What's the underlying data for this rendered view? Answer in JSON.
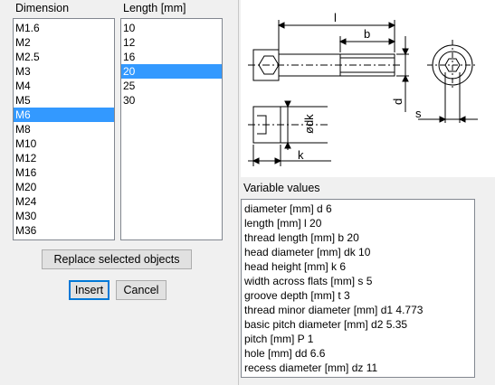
{
  "dimension": {
    "header": "Dimension",
    "items": [
      "M1.6",
      "M2",
      "M2.5",
      "M3",
      "M4",
      "M5",
      "M6",
      "M8",
      "M10",
      "M12",
      "M16",
      "M20",
      "M24",
      "M30",
      "M36"
    ],
    "selected": "M6"
  },
  "length": {
    "header": "Length [mm]",
    "items": [
      "10",
      "12",
      "16",
      "20",
      "25",
      "30"
    ],
    "selected": "20"
  },
  "buttons": {
    "replace": "Replace selected objects",
    "insert": "Insert",
    "cancel": "Cancel"
  },
  "drawing": {
    "labels": {
      "l": "l",
      "b": "b",
      "d": "d",
      "dk": "ødk",
      "k": "k",
      "s": "s"
    }
  },
  "variables": {
    "label": "Variable values",
    "lines": [
      "diameter [mm] d 6",
      "length [mm] l 20",
      "thread length [mm] b 20",
      "head diameter [mm] dk 10",
      "head height [mm] k 6",
      "width across flats [mm] s 5",
      "groove depth [mm] t 3",
      "thread minor diameter [mm] d1 4.773",
      "basic pitch diameter [mm] d2 5.35",
      "pitch [mm] P 1",
      "hole [mm] dd 6.6",
      "recess diameter [mm] dz 11"
    ]
  },
  "colors": {
    "selection": "#3399ff",
    "default_button_border": "#0078d7"
  }
}
